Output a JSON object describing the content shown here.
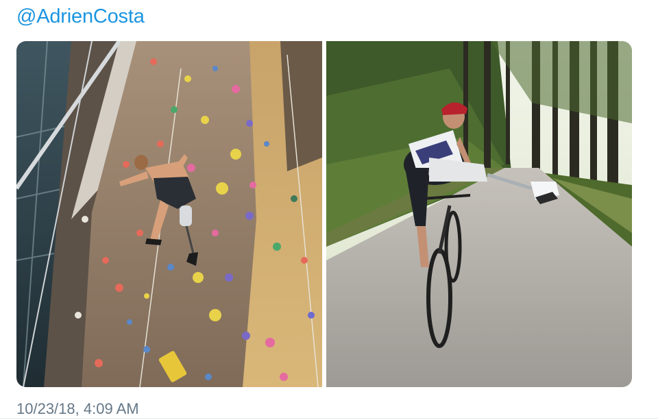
{
  "tweet": {
    "handle": "@AdrienCosta",
    "timestamp": "10/23/18, 4:09 AM"
  },
  "media": [
    {
      "subject": "indoor climbing wall with amputee climber"
    },
    {
      "subject": "cyclist on forest road raising prosthetic leg"
    }
  ],
  "colors": {
    "link": "#1b95e0",
    "timestamp": "#657786"
  }
}
